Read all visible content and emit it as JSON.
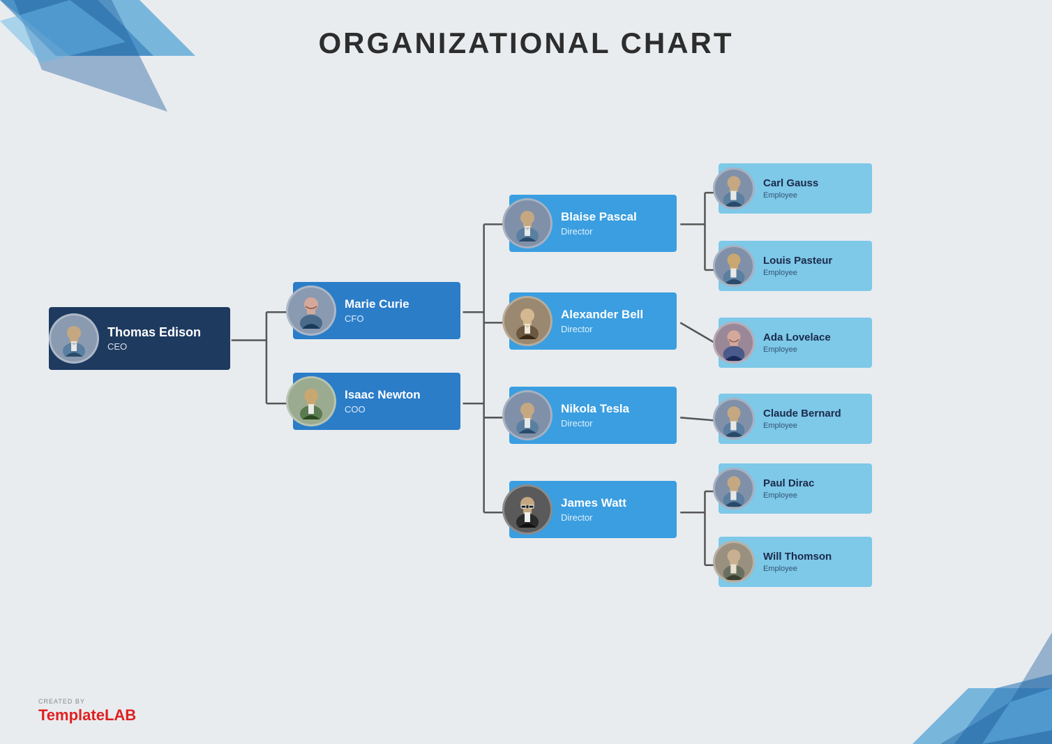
{
  "title": "ORGANIZATIONAL CHART",
  "nodes": {
    "ceo": {
      "name": "Thomas Edison",
      "role": "CEO",
      "avatar_type": "male_suit"
    },
    "vp1": {
      "name": "Marie Curie",
      "role": "CFO",
      "avatar_type": "female_suit"
    },
    "vp2": {
      "name": "Isaac Newton",
      "role": "COO",
      "avatar_type": "male_suit2"
    },
    "dir1": {
      "name": "Blaise Pascal",
      "role": "Director",
      "avatar_type": "male_suit"
    },
    "dir2": {
      "name": "Alexander Bell",
      "role": "Director",
      "avatar_type": "male_suit3"
    },
    "dir3": {
      "name": "Nikola Tesla",
      "role": "Director",
      "avatar_type": "male_suit"
    },
    "dir4": {
      "name": "James Watt",
      "role": "Director",
      "avatar_type": "male_glasses"
    },
    "emp1": {
      "name": "Carl Gauss",
      "role": "Employee",
      "avatar_type": "male_suit"
    },
    "emp2": {
      "name": "Louis Pasteur",
      "role": "Employee",
      "avatar_type": "male_suit"
    },
    "emp3": {
      "name": "Ada Lovelace",
      "role": "Employee",
      "avatar_type": "female_suit"
    },
    "emp4": {
      "name": "Claude Bernard",
      "role": "Employee",
      "avatar_type": "male_suit"
    },
    "emp5": {
      "name": "Paul Dirac",
      "role": "Employee",
      "avatar_type": "male_suit"
    },
    "emp6": {
      "name": "Will Thomson",
      "role": "Employee",
      "avatar_type": "male_suit2"
    }
  },
  "colors": {
    "ceo_bg": "#1e3a5f",
    "vp_bg": "#2b7dc8",
    "director_bg": "#3a9ee0",
    "employee_bg": "#7ec8e8",
    "line_color": "#444",
    "bg": "#e8ecef"
  },
  "logo": {
    "created_by": "CREATED BY",
    "brand1": "Template",
    "brand2": "LAB"
  }
}
